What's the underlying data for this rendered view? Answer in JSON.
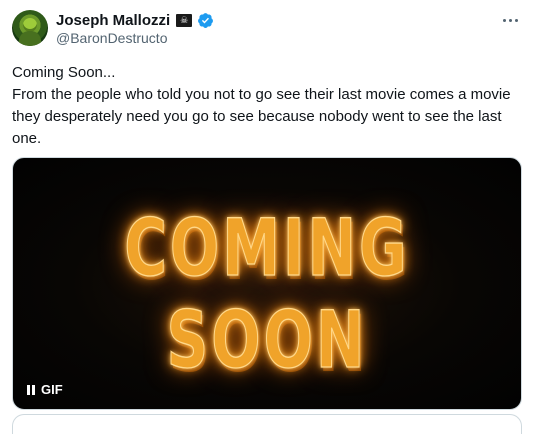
{
  "author": {
    "display_name": "Joseph Mallozzi",
    "flag_glyph": "☠",
    "handle": "@BaronDestructo",
    "verified_color": "#1d9bf0"
  },
  "tweet": {
    "text": "Coming Soon...\nFrom the people who told you not to go see their last movie comes a movie they desperately need you go to see because nobody went to see the last one."
  },
  "media": {
    "title": "COMING SOON",
    "badge": "GIF",
    "title_color": "#f0a32a"
  },
  "icons": [
    "avatar",
    "pirate-flag-icon",
    "verified-badge-icon",
    "more-options-icon",
    "pause-icon"
  ]
}
